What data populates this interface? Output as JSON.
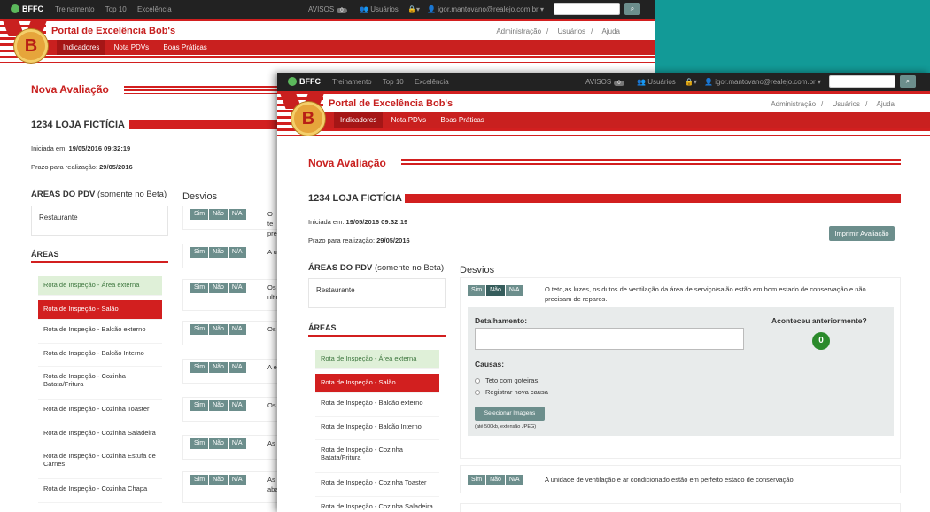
{
  "nav": {
    "brand": "BFFC",
    "items": [
      "Treinamento",
      "Top 10",
      "Excelência"
    ],
    "avisos_label": "AVISOS",
    "avisos_count": "0",
    "usuarios_label": "Usuários",
    "user_email": "igor.mantovano@realejo.com.br"
  },
  "header": {
    "title": "Portal de Excelência Bob's",
    "medal_letter": "B",
    "links": [
      "Administração",
      "Usuários",
      "Ajuda"
    ],
    "link_separator": "/",
    "subnav": [
      "Indicadores",
      "Nota PDVs",
      "Boas Práticas"
    ]
  },
  "page": {
    "title": "Nova Avaliação",
    "store": "1234 LOJA FICTÍCIA",
    "started_label": "Iniciada em:",
    "started_value": "19/05/2016 09:32:19",
    "deadline_label": "Prazo para realização:",
    "deadline_value": "29/05/2016",
    "print_button": "Imprimir Avaliação",
    "areas_pdv_label": "ÁREAS DO PDV",
    "areas_pdv_note": "(somente no Beta)",
    "areas_pdv_value": "Restaurante",
    "areas_label": "ÁREAS",
    "desvios_label": "Desvios"
  },
  "areas": {
    "back_items": [
      "Rota de Inspeção - Área externa",
      "Rota de Inspeção - Salão",
      "Rota de Inspeção - Balcão externo",
      "Rota de Inspeção - Balcão Interno",
      "Rota de Inspeção - Cozinha Batata/Fritura",
      "Rota de Inspeção - Cozinha Toaster",
      "Rota de Inspeção - Cozinha Saladeira",
      "Rota de Inspeção - Cozinha Estufa de Carnes",
      "Rota de Inspeção - Cozinha Chapa"
    ],
    "front_items": [
      "Rota de Inspeção - Área externa",
      "Rota de Inspeção - Salão",
      "Rota de Inspeção - Balcão externo",
      "Rota de Inspeção - Balcão Interno",
      "Rota de Inspeção - Cozinha Batata/Fritura",
      "Rota de Inspeção - Cozinha Toaster",
      "Rota de Inspeção - Cozinha Saladeira"
    ]
  },
  "answers": {
    "sim": "Sim",
    "nao": "Não",
    "na": "N/A"
  },
  "back_desvios_snippets": [
    "O te",
    "prec",
    "A u",
    "Os",
    "ultir",
    "Os",
    "A e",
    "Os",
    "As",
    "As",
    "aba"
  ],
  "desvios": [
    {
      "text": "O teto,as luzes, os dutos de ventilação da área de serviço/salão estão em bom estado de conservação e não precisam de reparos.",
      "selected": "nao",
      "detalhamento_label": "Detalhamento:",
      "aconteceu_label": "Aconteceu anteriormente?",
      "aconteceu_count": "0",
      "causas_label": "Causas:",
      "causas": [
        "Teto com goteiras.",
        "Registrar nova causa"
      ],
      "select_images_button": "Selecionar Imagens",
      "images_note": "(até 500kb, extensão JPEG)"
    },
    {
      "text": "A unidade de ventilação e ar condicionado estão em perfeito estado de conservação.",
      "selected": ""
    }
  ],
  "colors": {
    "accent": "#c9201f",
    "teal_bg": "#129a97",
    "button": "#6c8e8c",
    "success": "#2b8a2b"
  }
}
